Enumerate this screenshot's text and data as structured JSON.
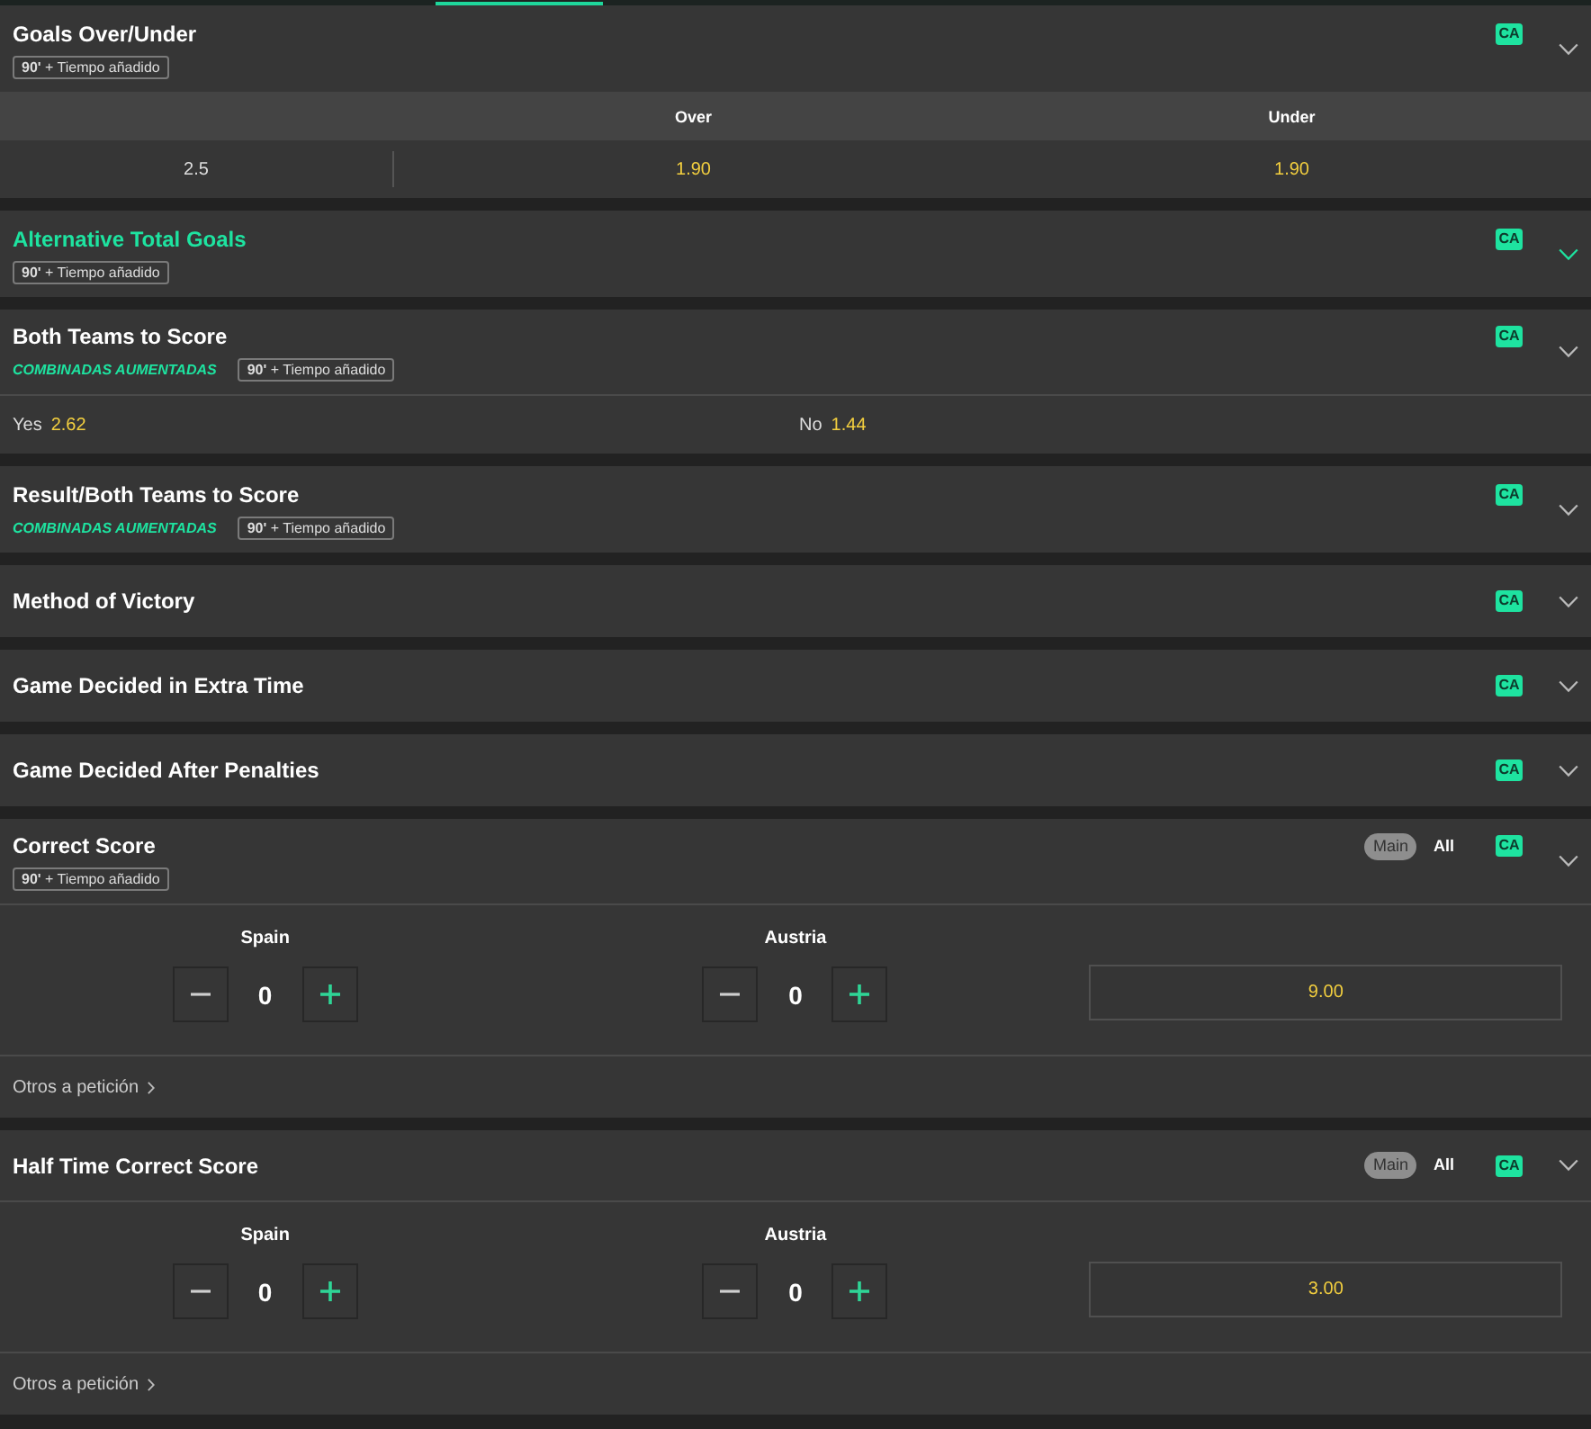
{
  "markets": [
    {
      "kind": "over_under",
      "title": "Goals Over/Under",
      "highlighted": false,
      "time_badge": "**90'** + Tiempo añadido",
      "ca_badge": "CA",
      "columns": [
        "Over",
        "Under"
      ],
      "rows": [
        {
          "line": "2.5",
          "odds": [
            "1.90",
            "1.90"
          ]
        }
      ]
    },
    {
      "kind": "collapsed",
      "title": "Alternative Total Goals",
      "highlighted": true,
      "time_badge": "**90'** + Tiempo añadido",
      "ca_badge": "CA"
    },
    {
      "kind": "two_way",
      "title": "Both Teams to Score",
      "highlighted": false,
      "promo": "COMBINADAS AUMENTADAS",
      "time_badge": "**90'** + Tiempo añadido",
      "ca_badge": "CA",
      "options": [
        {
          "label": "Yes",
          "odds": "2.62"
        },
        {
          "label": "No",
          "odds": "1.44"
        }
      ]
    },
    {
      "kind": "collapsed",
      "title": "Result/Both Teams to Score",
      "highlighted": false,
      "promo": "COMBINADAS AUMENTADAS",
      "time_badge": "**90'** + Tiempo añadido",
      "ca_badge": "CA"
    },
    {
      "kind": "collapsed",
      "title": "Method of Victory",
      "highlighted": false,
      "ca_badge": "CA"
    },
    {
      "kind": "collapsed",
      "title": "Game Decided in Extra Time",
      "highlighted": false,
      "ca_badge": "CA"
    },
    {
      "kind": "collapsed",
      "title": "Game Decided After Penalties",
      "highlighted": false,
      "ca_badge": "CA"
    },
    {
      "kind": "score_picker",
      "title": "Correct Score",
      "highlighted": false,
      "time_badge": "**90'** + Tiempo añadido",
      "view_toggle": [
        {
          "label": "Main",
          "selected": true
        },
        {
          "label": "All",
          "selected": false
        }
      ],
      "ca_badge": "CA",
      "teams": [
        {
          "name": "Spain",
          "score": "0"
        },
        {
          "name": "Austria",
          "score": "0"
        }
      ],
      "odds": "9.00",
      "more_link": "Otros a petición"
    },
    {
      "kind": "score_picker",
      "title": "Half Time Correct Score",
      "highlighted": false,
      "view_toggle": [
        {
          "label": "Main",
          "selected": true
        },
        {
          "label": "All",
          "selected": false
        }
      ],
      "ca_badge": "CA",
      "teams": [
        {
          "name": "Spain",
          "score": "0"
        },
        {
          "name": "Austria",
          "score": "0"
        }
      ],
      "odds": "3.00",
      "more_link": "Otros a petición"
    }
  ]
}
